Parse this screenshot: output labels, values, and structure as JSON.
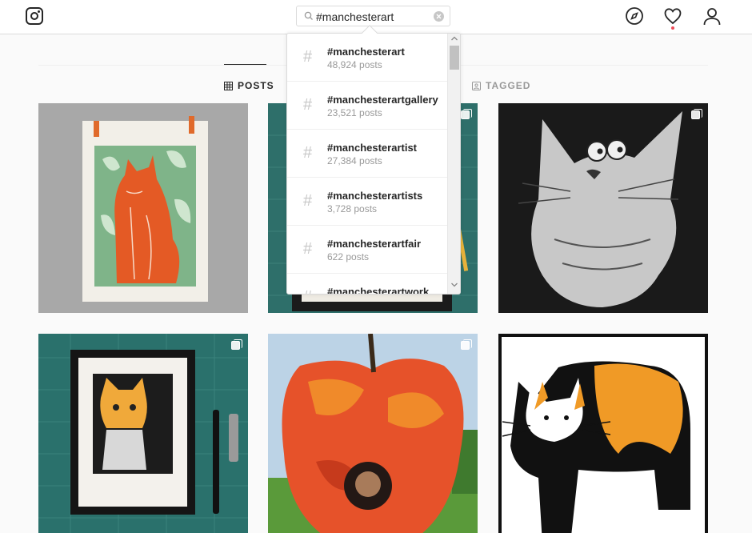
{
  "header": {
    "search_value": "#manchesterart",
    "icons": [
      "instagram-logo-icon",
      "search-icon",
      "clear-icon",
      "compass-icon",
      "heart-icon",
      "user-icon"
    ]
  },
  "tabs": {
    "posts": "POSTS",
    "tagged": "TAGGED"
  },
  "search_results": [
    {
      "tag": "#manchesterart",
      "count": "48,924 posts"
    },
    {
      "tag": "#manchesterartgallery",
      "count": "23,521 posts"
    },
    {
      "tag": "#manchesterartist",
      "count": "27,384 posts"
    },
    {
      "tag": "#manchesterartists",
      "count": "3,728 posts"
    },
    {
      "tag": "#manchesterartfair",
      "count": "622 posts"
    },
    {
      "tag": "#manchesterartwork",
      "count": ""
    }
  ],
  "posts": [
    {
      "subject": "orange cat linocut print on green leaves"
    },
    {
      "subject": "cat print on teal cutting mat"
    },
    {
      "subject": "black and white etched cat"
    },
    {
      "subject": "framed orange and black cat linocut"
    },
    {
      "subject": "red apple photo cutout with face"
    },
    {
      "subject": "calico cat illustration"
    }
  ],
  "colors": {
    "accent_red": "#ed4956",
    "border": "#dbdbdb",
    "secondary_text": "#999999"
  }
}
